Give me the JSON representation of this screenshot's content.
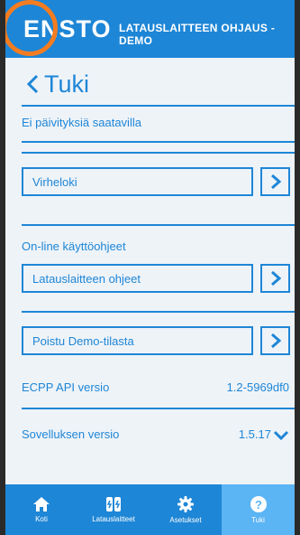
{
  "header": {
    "logo": "ENSTO",
    "title": "LATAUSLAITTEEN OHJAUS - DEMO"
  },
  "page": {
    "back_label": "Tuki"
  },
  "updates": {
    "text": "Ei päivityksiä saatavilla"
  },
  "error_log": {
    "label": "Virheloki"
  },
  "online_help": {
    "heading": "On-line käyttöohjeet",
    "charger_manual": "Latauslaitteen ohjeet"
  },
  "demo": {
    "exit_label": "Poistu Demo-tilasta"
  },
  "api_version": {
    "label": "ECPP API versio",
    "value": "1.2-5969df0"
  },
  "app_version": {
    "label": "Sovelluksen versio",
    "value": "1.5.17"
  },
  "tabs": [
    {
      "label": "Koti",
      "icon": "home-icon"
    },
    {
      "label": "Latauslaitteet",
      "icon": "charger-icon"
    },
    {
      "label": "Asetukset",
      "icon": "gear-icon"
    },
    {
      "label": "Tuki",
      "icon": "help-icon",
      "active": true
    }
  ],
  "colors": {
    "primary": "#1e86d6",
    "background": "#eef3f8",
    "active_tab": "#5bb4f4",
    "highlight": "#f47c20"
  }
}
